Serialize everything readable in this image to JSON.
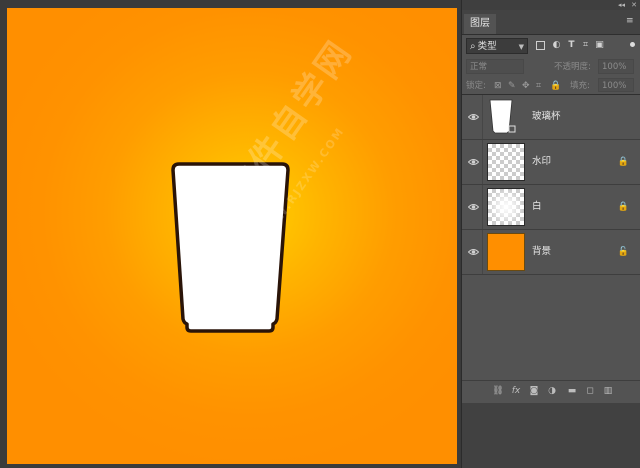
{
  "panel": {
    "tab_label": "图层",
    "topbar_arrows": "◂◂",
    "topbar_close": "✕",
    "menu_glyph": "≡"
  },
  "filter": {
    "search_glyph": "⌕",
    "kind_label": "类型"
  },
  "blend": {
    "mode": "正常",
    "opacity_label": "不透明度:",
    "opacity_value": "100%"
  },
  "lock": {
    "label": "锁定:",
    "fill_label": "填充:",
    "fill_value": "100%"
  },
  "layers": [
    {
      "name": "玻璃杯",
      "thumb": "cup",
      "locked": false
    },
    {
      "name": "水印",
      "thumb": "transparent",
      "locked": true,
      "lock_glyph": "🔒"
    },
    {
      "name": "白",
      "thumb": "white-glow",
      "locked": true,
      "lock_glyph": "🔒"
    },
    {
      "name": "背景",
      "thumb": "orange",
      "locked": true,
      "lock_glyph": "🔓"
    }
  ],
  "canvas": {
    "background_center_color": "#ffd000",
    "background_edge_color": "#ff8f00",
    "watermark_text": "软件自学网",
    "watermark_sub": "WWW.RJZXW.COM"
  },
  "colors": {
    "panel_bg": "#535353",
    "accent_orange": "#ff8f00"
  }
}
